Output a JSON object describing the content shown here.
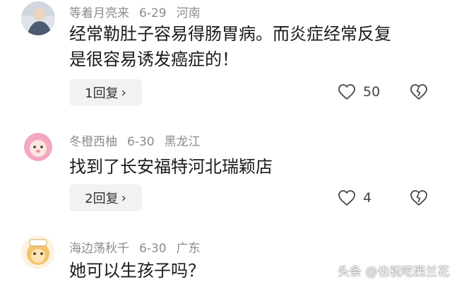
{
  "comments": [
    {
      "username": "等着月亮来",
      "date": "6-29",
      "location": "河南",
      "text": "经常勒肚子容易得肠胃病。而炎症经常反复是很容易诱发癌症的！",
      "reply_label": "1回复",
      "likes": "50",
      "avatar_icon": "person-photo-avatar"
    },
    {
      "username": "冬橙西柚",
      "date": "6-30",
      "location": "黑龙江",
      "text": "找到了长安福特河北瑞颖店",
      "reply_label": "2回复",
      "likes": "4",
      "avatar_icon": "lion-avatar"
    },
    {
      "username": "海边荡秋千",
      "date": "6-30",
      "location": "广东",
      "text": "她可以生孩子吗？",
      "avatar_icon": "cartoon-bear-avatar"
    }
  ],
  "watermark": "头条 @也祝呓西兰花",
  "colors": {
    "meta_text": "#8c8c8c",
    "reply_bg": "#f2f2f2",
    "content_text": "#1a1a1a"
  }
}
